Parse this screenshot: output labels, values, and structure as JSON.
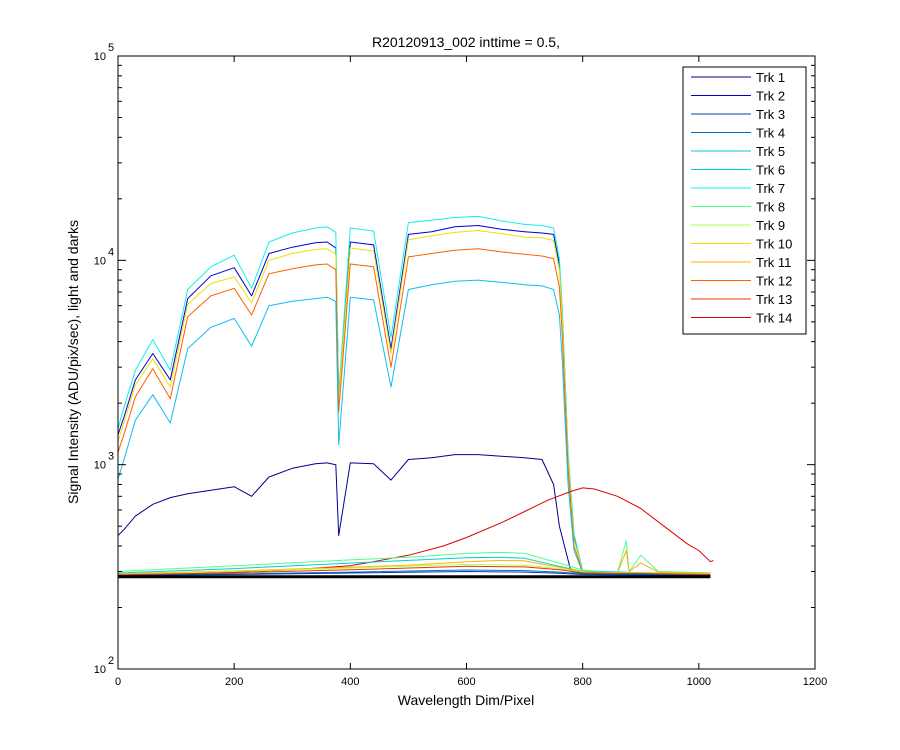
{
  "chart_data": {
    "type": "line",
    "title": "R20120913_002 inttime = 0.5,",
    "xlabel": "Wavelength Dim/Pixel",
    "ylabel": "Signal Intensity (ADU/pix/sec), light and darks",
    "xlim": [
      0,
      1200
    ],
    "ylim": [
      100,
      100000
    ],
    "yscale": "log",
    "x_ticks": [
      "0",
      "200",
      "400",
      "600",
      "800",
      "1000",
      "1200"
    ],
    "y_ticks": [
      {
        "base": "10",
        "exp": "2"
      },
      {
        "base": "10",
        "exp": "3"
      },
      {
        "base": "10",
        "exp": "4"
      },
      {
        "base": "10",
        "exp": "5"
      }
    ],
    "grid": false,
    "legend_position": "top-right",
    "series": [
      {
        "name": "Trk 1",
        "color": "#00008F",
        "x": [
          0,
          10,
          30,
          60,
          90,
          120,
          160,
          200,
          230,
          260,
          300,
          340,
          360,
          375,
          380,
          400,
          440,
          470,
          500,
          540,
          580,
          620,
          660,
          700,
          730,
          750,
          760,
          780,
          820,
          900,
          1020
        ],
        "y": [
          450,
          480,
          560,
          640,
          690,
          720,
          750,
          780,
          700,
          870,
          960,
          1010,
          1020,
          1000,
          450,
          1020,
          1010,
          840,
          1060,
          1080,
          1120,
          1120,
          1100,
          1080,
          1060,
          800,
          500,
          300,
          290,
          289,
          288
        ]
      },
      {
        "name": "Trk 2",
        "color": "#0000CF",
        "x": [
          0,
          10,
          30,
          60,
          90,
          120,
          160,
          200,
          230,
          260,
          300,
          340,
          360,
          375,
          380,
          400,
          440,
          470,
          500,
          540,
          580,
          620,
          660,
          700,
          730,
          750,
          760,
          765,
          775,
          785,
          800,
          900,
          1020
        ],
        "y": [
          1400,
          1700,
          2600,
          3500,
          2600,
          6500,
          8400,
          9200,
          6700,
          10800,
          11600,
          12200,
          12300,
          11500,
          2100,
          12300,
          11900,
          3700,
          13400,
          13800,
          14600,
          14800,
          14200,
          13800,
          13600,
          13400,
          9500,
          5500,
          1100,
          450,
          300,
          295,
          290
        ]
      },
      {
        "name": "Trk 7",
        "color": "#10EFEF",
        "x": [
          0,
          10,
          30,
          60,
          90,
          120,
          160,
          200,
          230,
          260,
          300,
          340,
          360,
          375,
          380,
          400,
          440,
          470,
          500,
          540,
          580,
          620,
          660,
          700,
          730,
          750,
          760,
          765,
          775,
          785,
          800,
          900,
          1020
        ],
        "y": [
          1500,
          1900,
          2900,
          4100,
          2900,
          7200,
          9300,
          10600,
          7300,
          12300,
          13600,
          14400,
          14600,
          13700,
          2200,
          14400,
          13900,
          4200,
          15300,
          15700,
          16200,
          16400,
          15600,
          15000,
          14800,
          14400,
          10200,
          5800,
          1150,
          460,
          302,
          296,
          290
        ]
      },
      {
        "name": "Trk 10",
        "color": "#EFE000",
        "x": [
          0,
          10,
          30,
          60,
          90,
          120,
          160,
          200,
          230,
          260,
          300,
          340,
          360,
          375,
          380,
          400,
          440,
          470,
          500,
          540,
          580,
          620,
          660,
          700,
          730,
          750,
          760,
          765,
          775,
          785,
          800,
          900,
          1020
        ],
        "y": [
          1300,
          1600,
          2450,
          3300,
          2400,
          6100,
          7700,
          8300,
          6200,
          10000,
          10800,
          11300,
          11400,
          10700,
          2000,
          11500,
          11100,
          3500,
          12600,
          13200,
          13700,
          14000,
          13500,
          13000,
          12900,
          12500,
          8900,
          5200,
          1050,
          430,
          300,
          295,
          290
        ]
      },
      {
        "name": "Trk 12",
        "color": "#FF6000",
        "x": [
          0,
          10,
          30,
          60,
          90,
          120,
          160,
          200,
          230,
          260,
          300,
          340,
          360,
          375,
          380,
          400,
          440,
          470,
          500,
          540,
          580,
          620,
          660,
          700,
          730,
          750,
          760,
          765,
          775,
          785,
          800,
          900,
          1020
        ],
        "y": [
          1150,
          1400,
          2150,
          2950,
          2100,
          5300,
          6700,
          7300,
          5400,
          8600,
          9100,
          9500,
          9600,
          9000,
          1800,
          9600,
          9300,
          3000,
          10400,
          10800,
          11200,
          11400,
          11000,
          10700,
          10500,
          10200,
          7400,
          4300,
          950,
          400,
          298,
          294,
          290
        ]
      },
      {
        "name": "Trk 5",
        "color": "#10BFEF",
        "x": [
          0,
          10,
          30,
          60,
          90,
          120,
          160,
          200,
          230,
          260,
          300,
          340,
          360,
          375,
          380,
          400,
          440,
          470,
          500,
          540,
          580,
          620,
          660,
          700,
          730,
          750,
          760,
          765,
          775,
          785,
          800,
          900,
          1020
        ],
        "y": [
          850,
          1050,
          1650,
          2200,
          1600,
          3700,
          4700,
          5200,
          3800,
          6000,
          6300,
          6500,
          6600,
          6300,
          1250,
          6600,
          6400,
          2400,
          7200,
          7600,
          7900,
          8000,
          7800,
          7600,
          7500,
          7200,
          5400,
          3200,
          800,
          380,
          296,
          292,
          290
        ]
      },
      {
        "name": "Trk 14",
        "color": "#DF0000",
        "x": [
          0,
          100,
          200,
          300,
          400,
          500,
          560,
          600,
          660,
          700,
          740,
          780,
          800,
          820,
          860,
          900,
          940,
          980,
          1000,
          1020,
          1025
        ],
        "y": [
          285,
          290,
          298,
          306,
          320,
          360,
          400,
          440,
          520,
          590,
          670,
          740,
          770,
          760,
          700,
          610,
          500,
          410,
          380,
          335,
          340
        ]
      },
      {
        "name": "Trk 8",
        "color": "#50FF8F",
        "x": [
          0,
          200,
          400,
          500,
          600,
          660,
          700,
          760,
          800,
          860,
          875,
          880,
          900,
          930,
          1020
        ],
        "y": [
          300,
          320,
          342,
          352,
          368,
          372,
          368,
          330,
          305,
          296,
          425,
          300,
          360,
          300,
          296
        ]
      },
      {
        "name": "Trk 6",
        "color": "#00CFCF",
        "x": [
          0,
          200,
          400,
          500,
          600,
          660,
          700,
          760,
          800,
          1020
        ],
        "y": [
          295,
          310,
          330,
          340,
          350,
          352,
          348,
          318,
          300,
          292
        ]
      },
      {
        "name": "Trk 11",
        "color": "#FFB000",
        "x": [
          0,
          200,
          400,
          500,
          600,
          660,
          700,
          760,
          800,
          860,
          875,
          880,
          900,
          930,
          1020
        ],
        "y": [
          292,
          302,
          315,
          322,
          335,
          340,
          338,
          315,
          300,
          294,
          380,
          300,
          330,
          298,
          294
        ]
      },
      {
        "name": "Trk 4",
        "color": "#0070C0",
        "x": [
          0,
          200,
          400,
          600,
          700,
          760,
          800,
          1020
        ],
        "y": [
          288,
          292,
          298,
          305,
          303,
          298,
          292,
          288
        ]
      },
      {
        "name": "Trk 3",
        "color": "#0040AF",
        "x": [
          0,
          200,
          400,
          600,
          700,
          760,
          800,
          1020
        ],
        "y": [
          287,
          290,
          295,
          300,
          298,
          294,
          290,
          287
        ]
      },
      {
        "name": "Trk 9",
        "color": "#AFFF50",
        "x": [
          0,
          200,
          400,
          600,
          700,
          760,
          800,
          1020
        ],
        "y": [
          290,
          300,
          312,
          325,
          322,
          310,
          298,
          292
        ]
      },
      {
        "name": "Trk 13",
        "color": "#EF3000",
        "x": [
          0,
          200,
          400,
          600,
          700,
          760,
          800,
          1020
        ],
        "y": [
          289,
          296,
          306,
          318,
          316,
          306,
          296,
          290
        ]
      }
    ],
    "dark_trace": {
      "color": "#000000",
      "x": [
        0,
        1020
      ],
      "y": [
        283,
        283
      ]
    }
  }
}
